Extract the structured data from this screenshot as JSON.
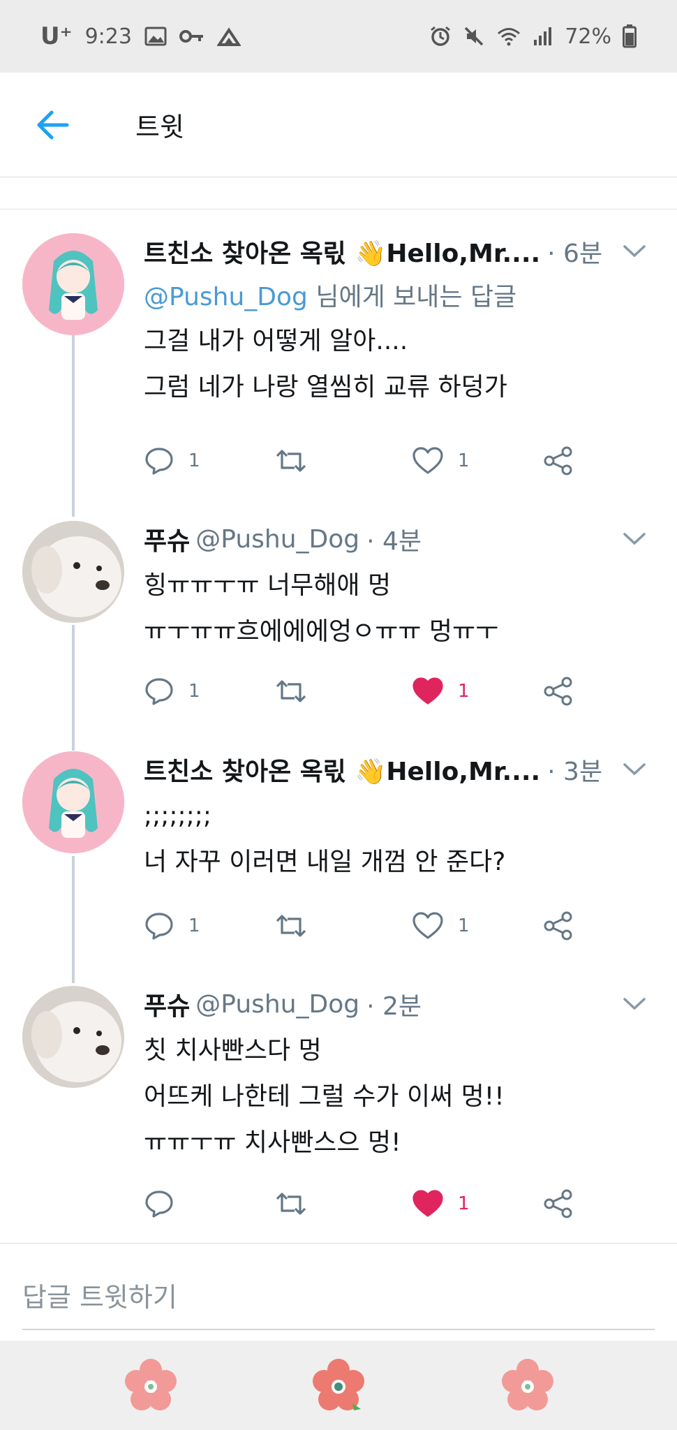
{
  "status_bar": {
    "carrier": "U⁺",
    "time": "9:23",
    "battery": "72%",
    "icons_left": [
      "image-icon",
      "key-icon",
      "cloud-icon"
    ],
    "icons_right": [
      "alarm-icon",
      "mute-icon",
      "wifi-icon",
      "signal-icon",
      "battery-icon"
    ]
  },
  "header": {
    "title": "트윗",
    "back_icon": "arrow-left-icon"
  },
  "tweets": [
    {
      "author": "트친소 찾아온 옥릯 👋Hello,Mr....",
      "handle": "",
      "time": "· 6분",
      "reply_to_mention": "@Pushu_Dog",
      "reply_to_suffix": " 님에게 보내는 답글",
      "lines": [
        "그걸 내가 어떻게 알아....",
        "그럼 네가 나랑 열씸히 교류 하덩가"
      ],
      "reply_count": "1",
      "like_count": "1",
      "liked": false
    },
    {
      "author": "푸슈",
      "handle": "@Pushu_Dog",
      "time": "· 4분",
      "lines": [
        "힝ㅠㅠㅜㅠ 너무해애 멍",
        "ㅠㅜㅠㅠ흐에에에엉ㅇㅠㅠ 멍ㅠㅜ"
      ],
      "reply_count": "1",
      "like_count": "1",
      "liked": true
    },
    {
      "author": "트친소 찾아온 옥릯 👋Hello,Mr....",
      "handle": "",
      "time": "· 3분",
      "lines": [
        ";;;;;;;;",
        "너 자꾸 이러면 내일 개껌 안 준다?"
      ],
      "reply_count": "1",
      "like_count": "1",
      "liked": false
    },
    {
      "author": "푸슈",
      "handle": "@Pushu_Dog",
      "time": "· 2분",
      "lines": [
        "칫 치사빤스다 멍",
        "어뜨케 나한테 그럴 수가 이써 멍!!",
        "ㅠㅠㅜㅠ 치사빤스으 멍!"
      ],
      "reply_count": "",
      "like_count": "1",
      "liked": true
    }
  ],
  "reply_box": {
    "placeholder": "답글 트윗하기"
  },
  "colors": {
    "accent": "#1da1f2",
    "like": "#e0245e",
    "mention": "#4a9ad4",
    "muted": "#657786"
  }
}
